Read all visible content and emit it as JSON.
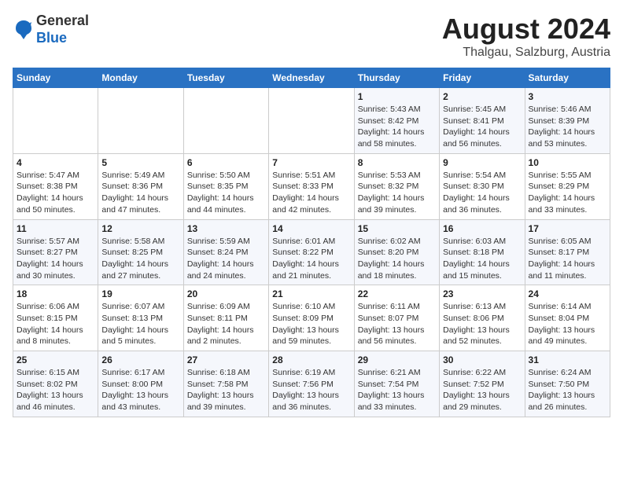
{
  "header": {
    "logo_line1": "General",
    "logo_line2": "Blue",
    "main_title": "August 2024",
    "subtitle": "Thalgau, Salzburg, Austria"
  },
  "weekdays": [
    "Sunday",
    "Monday",
    "Tuesday",
    "Wednesday",
    "Thursday",
    "Friday",
    "Saturday"
  ],
  "weeks": [
    [
      {
        "day": "",
        "info": ""
      },
      {
        "day": "",
        "info": ""
      },
      {
        "day": "",
        "info": ""
      },
      {
        "day": "",
        "info": ""
      },
      {
        "day": "1",
        "info": "Sunrise: 5:43 AM\nSunset: 8:42 PM\nDaylight: 14 hours\nand 58 minutes."
      },
      {
        "day": "2",
        "info": "Sunrise: 5:45 AM\nSunset: 8:41 PM\nDaylight: 14 hours\nand 56 minutes."
      },
      {
        "day": "3",
        "info": "Sunrise: 5:46 AM\nSunset: 8:39 PM\nDaylight: 14 hours\nand 53 minutes."
      }
    ],
    [
      {
        "day": "4",
        "info": "Sunrise: 5:47 AM\nSunset: 8:38 PM\nDaylight: 14 hours\nand 50 minutes."
      },
      {
        "day": "5",
        "info": "Sunrise: 5:49 AM\nSunset: 8:36 PM\nDaylight: 14 hours\nand 47 minutes."
      },
      {
        "day": "6",
        "info": "Sunrise: 5:50 AM\nSunset: 8:35 PM\nDaylight: 14 hours\nand 44 minutes."
      },
      {
        "day": "7",
        "info": "Sunrise: 5:51 AM\nSunset: 8:33 PM\nDaylight: 14 hours\nand 42 minutes."
      },
      {
        "day": "8",
        "info": "Sunrise: 5:53 AM\nSunset: 8:32 PM\nDaylight: 14 hours\nand 39 minutes."
      },
      {
        "day": "9",
        "info": "Sunrise: 5:54 AM\nSunset: 8:30 PM\nDaylight: 14 hours\nand 36 minutes."
      },
      {
        "day": "10",
        "info": "Sunrise: 5:55 AM\nSunset: 8:29 PM\nDaylight: 14 hours\nand 33 minutes."
      }
    ],
    [
      {
        "day": "11",
        "info": "Sunrise: 5:57 AM\nSunset: 8:27 PM\nDaylight: 14 hours\nand 30 minutes."
      },
      {
        "day": "12",
        "info": "Sunrise: 5:58 AM\nSunset: 8:25 PM\nDaylight: 14 hours\nand 27 minutes."
      },
      {
        "day": "13",
        "info": "Sunrise: 5:59 AM\nSunset: 8:24 PM\nDaylight: 14 hours\nand 24 minutes."
      },
      {
        "day": "14",
        "info": "Sunrise: 6:01 AM\nSunset: 8:22 PM\nDaylight: 14 hours\nand 21 minutes."
      },
      {
        "day": "15",
        "info": "Sunrise: 6:02 AM\nSunset: 8:20 PM\nDaylight: 14 hours\nand 18 minutes."
      },
      {
        "day": "16",
        "info": "Sunrise: 6:03 AM\nSunset: 8:18 PM\nDaylight: 14 hours\nand 15 minutes."
      },
      {
        "day": "17",
        "info": "Sunrise: 6:05 AM\nSunset: 8:17 PM\nDaylight: 14 hours\nand 11 minutes."
      }
    ],
    [
      {
        "day": "18",
        "info": "Sunrise: 6:06 AM\nSunset: 8:15 PM\nDaylight: 14 hours\nand 8 minutes."
      },
      {
        "day": "19",
        "info": "Sunrise: 6:07 AM\nSunset: 8:13 PM\nDaylight: 14 hours\nand 5 minutes."
      },
      {
        "day": "20",
        "info": "Sunrise: 6:09 AM\nSunset: 8:11 PM\nDaylight: 14 hours\nand 2 minutes."
      },
      {
        "day": "21",
        "info": "Sunrise: 6:10 AM\nSunset: 8:09 PM\nDaylight: 13 hours\nand 59 minutes."
      },
      {
        "day": "22",
        "info": "Sunrise: 6:11 AM\nSunset: 8:07 PM\nDaylight: 13 hours\nand 56 minutes."
      },
      {
        "day": "23",
        "info": "Sunrise: 6:13 AM\nSunset: 8:06 PM\nDaylight: 13 hours\nand 52 minutes."
      },
      {
        "day": "24",
        "info": "Sunrise: 6:14 AM\nSunset: 8:04 PM\nDaylight: 13 hours\nand 49 minutes."
      }
    ],
    [
      {
        "day": "25",
        "info": "Sunrise: 6:15 AM\nSunset: 8:02 PM\nDaylight: 13 hours\nand 46 minutes."
      },
      {
        "day": "26",
        "info": "Sunrise: 6:17 AM\nSunset: 8:00 PM\nDaylight: 13 hours\nand 43 minutes."
      },
      {
        "day": "27",
        "info": "Sunrise: 6:18 AM\nSunset: 7:58 PM\nDaylight: 13 hours\nand 39 minutes."
      },
      {
        "day": "28",
        "info": "Sunrise: 6:19 AM\nSunset: 7:56 PM\nDaylight: 13 hours\nand 36 minutes."
      },
      {
        "day": "29",
        "info": "Sunrise: 6:21 AM\nSunset: 7:54 PM\nDaylight: 13 hours\nand 33 minutes."
      },
      {
        "day": "30",
        "info": "Sunrise: 6:22 AM\nSunset: 7:52 PM\nDaylight: 13 hours\nand 29 minutes."
      },
      {
        "day": "31",
        "info": "Sunrise: 6:24 AM\nSunset: 7:50 PM\nDaylight: 13 hours\nand 26 minutes."
      }
    ]
  ]
}
